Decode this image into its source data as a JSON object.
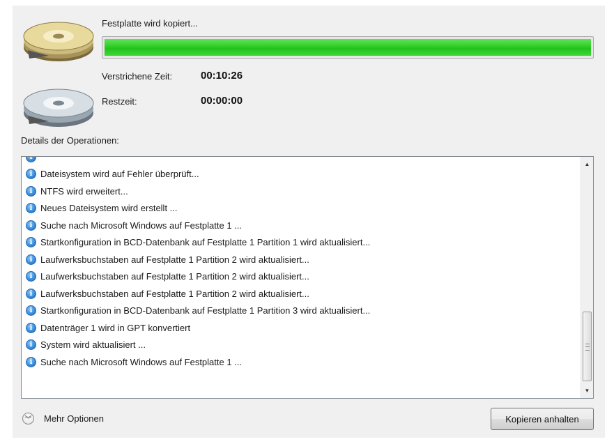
{
  "progress": {
    "status_text": "Festplatte wird kopiert...",
    "fraction": 1.0,
    "color": "#2fcd27"
  },
  "times": {
    "elapsed_label": "Verstrichene Zeit:",
    "elapsed_value": "00:10:26",
    "remaining_label": "Restzeit:",
    "remaining_value": "00:00:00"
  },
  "details": {
    "label": "Details der Operationen:",
    "items": [
      "Dateisystem wird auf Fehler überprüft...",
      "NTFS wird erweitert...",
      "Neues Dateisystem wird erstellt ...",
      "Suche nach Microsoft Windows auf Festplatte 1 ...",
      "Startkonfiguration in BCD-Datenbank auf Festplatte 1 Partition 1 wird aktualisiert...",
      "Laufwerksbuchstaben auf Festplatte 1 Partition 2 wird aktualisiert...",
      "Laufwerksbuchstaben auf Festplatte 1 Partition 2 wird aktualisiert...",
      "Laufwerksbuchstaben auf Festplatte 1 Partition 2 wird aktualisiert...",
      "Startkonfiguration in BCD-Datenbank auf Festplatte 1 Partition 3 wird aktualisiert...",
      "Datenträger 1 wird in GPT konvertiert",
      "System wird aktualisiert ...",
      "Suche nach Microsoft Windows auf Festplatte 1 ..."
    ],
    "item_icon": "info-icon"
  },
  "footer": {
    "more_options_label": "Mehr Optionen",
    "stop_button_label": "Kopieren anhalten"
  },
  "icons": {
    "source_disk": "gold-disk-icon",
    "target_disk": "silver-disk-icon",
    "expand": "chevron-double-down-icon"
  }
}
